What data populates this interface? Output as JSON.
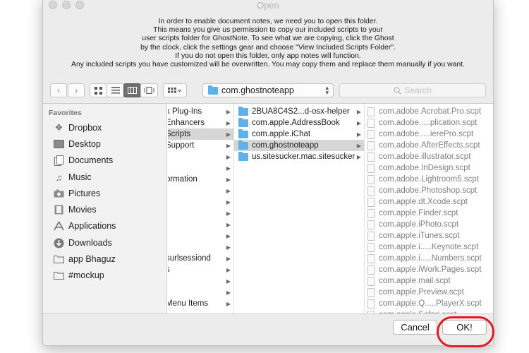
{
  "window": {
    "title": "Open"
  },
  "message": {
    "lines": [
      "In order to enable document notes, we need you to open this folder.",
      "This means you give us permission to copy our included scripts to your",
      "user scripts folder for GhostNote. To see what we are copying, click the Ghost",
      "by the clock, click the settings gear and choose \"View Included Scripts Folder\".",
      "If you do not open this folder, only app notes will function.",
      "Any included scripts you have customized will be overwritten. You may copy them and replace them manually if you want."
    ]
  },
  "toolbar": {
    "back_icon": "chevron-left-icon",
    "forward_icon": "chevron-right-icon",
    "views": [
      "icon-view-icon",
      "list-view-icon",
      "column-view-icon",
      "coverflow-view-icon"
    ],
    "active_view": "column-view-icon",
    "arrange_icon": "arrange-menu-icon",
    "location": "com.ghostnoteapp",
    "search_placeholder": "Search"
  },
  "sidebar": {
    "title": "Favorites",
    "items": [
      {
        "label": "Dropbox",
        "icon": "dropbox-icon"
      },
      {
        "label": "Desktop",
        "icon": "desktop-icon"
      },
      {
        "label": "Documents",
        "icon": "documents-icon"
      },
      {
        "label": "Music",
        "icon": "music-icon"
      },
      {
        "label": "Pictures",
        "icon": "pictures-icon"
      },
      {
        "label": "Movies",
        "icon": "movies-icon"
      },
      {
        "label": "Applications",
        "icon": "applications-icon"
      },
      {
        "label": "Downloads",
        "icon": "downloads-icon"
      },
      {
        "label": "app Bhaguz",
        "icon": "folder-icon"
      },
      {
        "label": "#mockup",
        "icon": "folder-icon"
      }
    ]
  },
  "columns": {
    "parent": [
      {
        "label": "k Plug-Ins",
        "arrow": true,
        "selected": false
      },
      {
        "label": "Enhancers",
        "arrow": true,
        "selected": false
      },
      {
        "label": "Scripts",
        "arrow": true,
        "selected": true
      },
      {
        "label": "Support",
        "arrow": true,
        "selected": false
      },
      {
        "label": "",
        "arrow": true,
        "selected": false
      },
      {
        "label": "",
        "arrow": true,
        "selected": false
      },
      {
        "label": "ormation",
        "arrow": true,
        "selected": false
      },
      {
        "label": "",
        "arrow": true,
        "selected": false
      },
      {
        "label": "",
        "arrow": true,
        "selected": false
      },
      {
        "label": "",
        "arrow": true,
        "selected": false
      },
      {
        "label": "",
        "arrow": true,
        "selected": false
      },
      {
        "label": "",
        "arrow": true,
        "selected": false
      },
      {
        "label": "",
        "arrow": true,
        "selected": false
      },
      {
        "label": "surlsessiond",
        "arrow": true,
        "selected": false
      },
      {
        "label": "s",
        "arrow": true,
        "selected": false
      },
      {
        "label": "",
        "arrow": true,
        "selected": false
      },
      {
        "label": "",
        "arrow": true,
        "selected": false
      },
      {
        "label": "Menu Items",
        "arrow": true,
        "selected": false
      },
      {
        "label": "",
        "arrow": true,
        "selected": false
      }
    ],
    "folders": [
      {
        "label": "2BUA8C4S2...d-osx-helper",
        "selected": false
      },
      {
        "label": "com.apple.AddressBook",
        "selected": false
      },
      {
        "label": "com.apple.iChat",
        "selected": false
      },
      {
        "label": "com.ghostnoteapp",
        "selected": true
      },
      {
        "label": "us.sitesucker.mac.sitesucker",
        "selected": false
      }
    ],
    "scripts": [
      "com.adobe.Acrobat.Pro.scpt",
      "com.adobe.....plication.scpt",
      "com.adobe.....ierePro.scpt",
      "com.adobe.AfterEffects.scpt",
      "com.adobe.illustrator.scpt",
      "com.adobe.InDesign.scpt",
      "com.adobe.Lightroom5.scpt",
      "com.adobe.Photoshop.scpt",
      "com.apple.dt.Xcode.scpt",
      "com.apple.Finder.scpt",
      "com.apple.iPhoto.scpt",
      "com.apple.iTunes.scpt",
      "com.apple.i.....Keynote.scpt",
      "com.apple.i.....Numbers.scpt",
      "com.apple.iWork.Pages.scpt",
      "com.apple.mail.scpt",
      "com.apple.Preview.scpt",
      "com.apple.Q.....PlayerX.scpt",
      "com.apple.Safari.scpt"
    ]
  },
  "footer": {
    "cancel_label": "Cancel",
    "ok_label": "OK!"
  },
  "colors": {
    "highlight_ring": "#e01b22",
    "folder": "#5fb1ec",
    "selection": "#d6d6d6"
  }
}
